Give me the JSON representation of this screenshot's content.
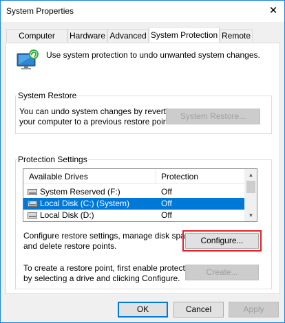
{
  "window": {
    "title": "System Properties",
    "close_glyph": "✕",
    "close_icon": "close-icon"
  },
  "tabs": [
    {
      "label": "Computer Name",
      "active": false
    },
    {
      "label": "Hardware",
      "active": false
    },
    {
      "label": "Advanced",
      "active": false
    },
    {
      "label": "System Protection",
      "active": true
    },
    {
      "label": "Remote",
      "active": false
    }
  ],
  "intro": {
    "icon": "system-protection-icon",
    "text": "Use system protection to undo unwanted system changes."
  },
  "system_restore": {
    "group_label": "System Restore",
    "description_line1": "You can undo system changes by reverting",
    "description_line2": "your computer to a previous restore point.",
    "button_label": "System Restore...",
    "button_enabled": false
  },
  "protection_settings": {
    "group_label": "Protection Settings",
    "columns": [
      "Available Drives",
      "Protection"
    ],
    "drives": [
      {
        "name": "System Reserved (F:)",
        "protection": "Off",
        "icon": "drive-icon",
        "selected": false
      },
      {
        "name": "Local Disk (C:) (System)",
        "protection": "Off",
        "icon": "system-drive-icon",
        "selected": true
      },
      {
        "name": "Local Disk (D:)",
        "protection": "Off",
        "icon": "drive-icon",
        "selected": false
      }
    ],
    "configure_text_line1": "Configure restore settings, manage disk space,",
    "configure_text_line2": "and delete restore points.",
    "configure_label": "Configure...",
    "create_text_line1": "To create a restore point, first enable protection",
    "create_text_line2": "by selecting a drive and clicking Configure.",
    "create_label": "Create...",
    "create_enabled": false
  },
  "footer": {
    "ok_label": "OK",
    "cancel_label": "Cancel",
    "apply_label": "Apply",
    "apply_enabled": false
  },
  "colors": {
    "accent": "#0078d7",
    "highlight_border": "#e21f26",
    "window_border": "#1883d7"
  }
}
